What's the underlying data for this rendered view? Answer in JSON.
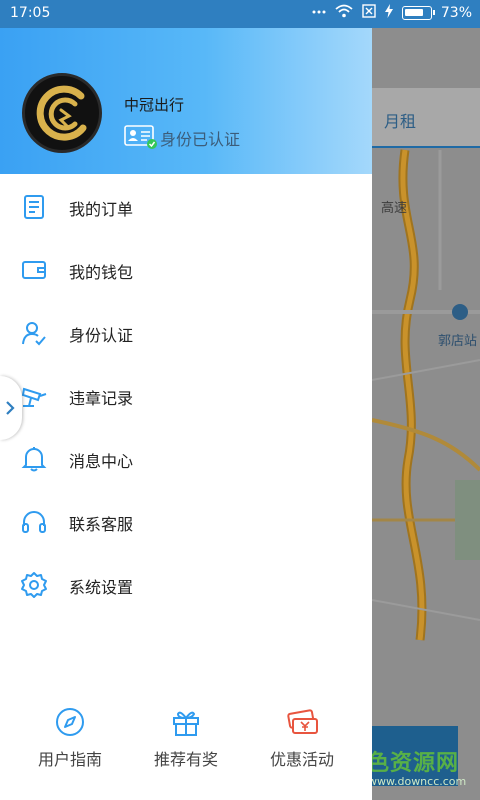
{
  "statusbar": {
    "time": "17:05",
    "battery_text": "73%",
    "battery_level": 0.73
  },
  "profile": {
    "name": "中冠出行",
    "verified_status": "身份已认证"
  },
  "menu": {
    "items": [
      {
        "label": "我的订单",
        "icon": "order-list-icon"
      },
      {
        "label": "我的钱包",
        "icon": "wallet-icon"
      },
      {
        "label": "身份认证",
        "icon": "id-verify-icon"
      },
      {
        "label": "违章记录",
        "icon": "camera-icon"
      },
      {
        "label": "消息中心",
        "icon": "bell-icon"
      },
      {
        "label": "联系客服",
        "icon": "headset-icon"
      },
      {
        "label": "系统设置",
        "icon": "gear-icon"
      }
    ]
  },
  "bottom_nav": {
    "items": [
      {
        "label": "用户指南",
        "icon": "compass-icon"
      },
      {
        "label": "推荐有奖",
        "icon": "gift-icon"
      },
      {
        "label": "优惠活动",
        "icon": "coupon-icon"
      }
    ]
  },
  "map": {
    "tab_label": "月租",
    "road_label": "高速",
    "station_label": "郭店站"
  },
  "watermark": {
    "text": "绿色资源网",
    "url": "www.downcc.com"
  },
  "colors": {
    "accent": "#2f9bef",
    "coupon": "#e8553f",
    "header_start": "#3aa1f3",
    "header_end": "#a4d8fb"
  }
}
